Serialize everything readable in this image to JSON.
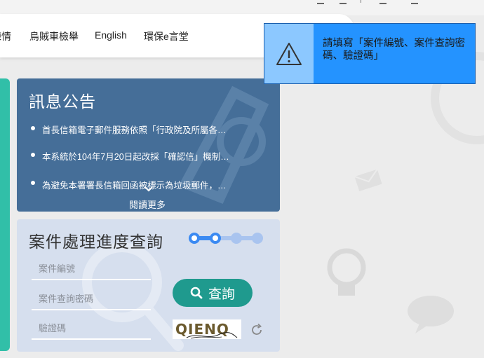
{
  "nav": {
    "items": [
      {
        "label": "陳情"
      },
      {
        "label": "烏賊車檢舉"
      },
      {
        "label": "English"
      },
      {
        "label": "環保e言堂"
      }
    ]
  },
  "notice": {
    "title": "訊息公告",
    "items": [
      {
        "text": "首長信箱電子郵件服務依照「行政院及所屬各…"
      },
      {
        "text": "本系統於104年7月20日起改採「確認信」機制…"
      },
      {
        "text": "為避免本署署長信箱回函被標示為垃圾郵件，…"
      }
    ],
    "read_more": "閱讀更多"
  },
  "progress": {
    "title": "案件處理進度查詢",
    "case_number_placeholder": "案件編號",
    "case_password_placeholder": "案件查詢密碼",
    "captcha_placeholder": "驗證碼",
    "query_label": "查詢",
    "captcha_text": "QIENQ"
  },
  "alert": {
    "message": "請填寫「案件編號、案件查詢密碼、驗證碼」"
  },
  "colors": {
    "notice_bg": "#456e98",
    "progress_bg": "#d6dfee",
    "query_button": "#1f9a8e",
    "alert_bg": "#2493ff",
    "alert_icon_bg": "#8cc8ff",
    "left_bar": "#31bfa8"
  },
  "icons": {
    "alert": "warning-triangle-icon",
    "query": "search-icon",
    "captcha_refresh": "refresh-icon",
    "read_more": "chevron-down-icon",
    "steps": "progress-steps-icon"
  }
}
